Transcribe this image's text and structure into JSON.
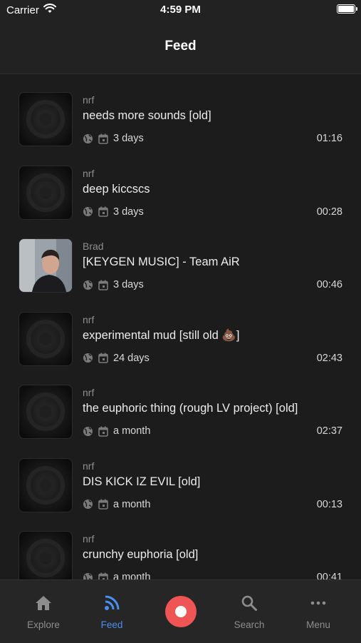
{
  "status": {
    "carrier": "Carrier",
    "time": "4:59 PM"
  },
  "nav": {
    "title": "Feed"
  },
  "feed": [
    {
      "author": "nrf",
      "title": "needs more sounds [old]",
      "age": "3 days",
      "duration": "01:16",
      "thumb": "default"
    },
    {
      "author": "nrf",
      "title": "deep kiccscs",
      "age": "3 days",
      "duration": "00:28",
      "thumb": "default"
    },
    {
      "author": "Brad",
      "title": "[KEYGEN MUSIC] - Team AiR",
      "age": "3 days",
      "duration": "00:46",
      "thumb": "photo"
    },
    {
      "author": "nrf",
      "title": "experimental mud [still old 💩]",
      "age": "24 days",
      "duration": "02:43",
      "thumb": "default"
    },
    {
      "author": "nrf",
      "title": "the euphoric thing (rough LV project) [old]",
      "age": "a month",
      "duration": "02:37",
      "thumb": "default"
    },
    {
      "author": "nrf",
      "title": "DIS KICK IZ EVIL [old]",
      "age": "a month",
      "duration": "00:13",
      "thumb": "default"
    },
    {
      "author": "nrf",
      "title": "crunchy euphoria [old]",
      "age": "a month",
      "duration": "00:41",
      "thumb": "default"
    }
  ],
  "tabs": [
    {
      "label": "Explore",
      "icon": "home-icon",
      "active": false
    },
    {
      "label": "Feed",
      "icon": "rss-icon",
      "active": true
    },
    {
      "label": "",
      "icon": "record-icon",
      "active": false
    },
    {
      "label": "Search",
      "icon": "search-icon",
      "active": false
    },
    {
      "label": "Menu",
      "icon": "more-icon",
      "active": false
    }
  ],
  "colors": {
    "accent": "#4b8ef2",
    "record": "#f05555",
    "background": "#1c1c1c"
  }
}
